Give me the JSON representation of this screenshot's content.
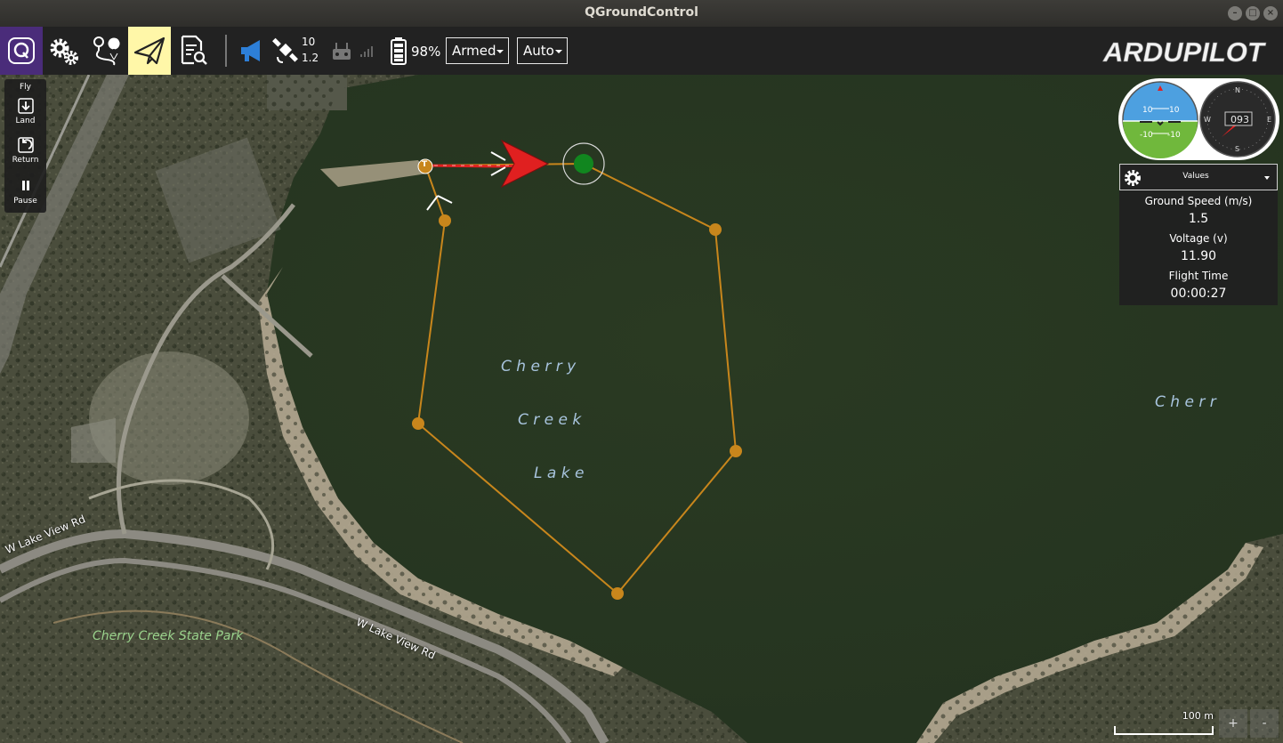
{
  "window": {
    "title": "QGroundControl"
  },
  "toolbar": {
    "satellite_count": "10",
    "hdop": "1.2",
    "battery_percent": "98%",
    "arm_state": "Armed",
    "flight_mode": "Auto",
    "logo_text": "ARDUPILOT"
  },
  "fly_panel": {
    "header": "Fly",
    "land": "Land",
    "return": "Return",
    "pause": "Pause"
  },
  "map": {
    "lake_line1": "C h e r r y",
    "lake_line2": "C r e e k",
    "lake_line3": "L a k e",
    "lake_right": "C h e r r",
    "park_label": "Cherry Creek State Park",
    "road_label_1": "W Lake View Rd",
    "road_label_2": "W Lake View Rd",
    "road_label_3": "Rd",
    "takeoff_marker": "T",
    "scale_label": "100 m",
    "zoom_in": "+",
    "zoom_out": "-"
  },
  "instruments": {
    "attitude_pitch_up": "10",
    "attitude_pitch_up_r": "10",
    "attitude_pitch_down": "-10",
    "attitude_pitch_down_r": "-10",
    "heading_value": "093",
    "compass_n": "N",
    "compass_s": "S",
    "compass_e": "E",
    "compass_w": "W"
  },
  "values_panel": {
    "header": "Values",
    "items": [
      {
        "label": "Ground Speed (m/s)",
        "value": "1.5"
      },
      {
        "label": "Voltage (v)",
        "value": "11.90"
      },
      {
        "label": "Flight Time",
        "value": "00:00:27"
      }
    ]
  },
  "colors": {
    "accent_purple": "#4a2c7a",
    "plan_highlight": "#fff7a8",
    "mission_path": "#c8861c",
    "vehicle_red": "#e02020",
    "gps_blue": "#2d7fd8"
  }
}
